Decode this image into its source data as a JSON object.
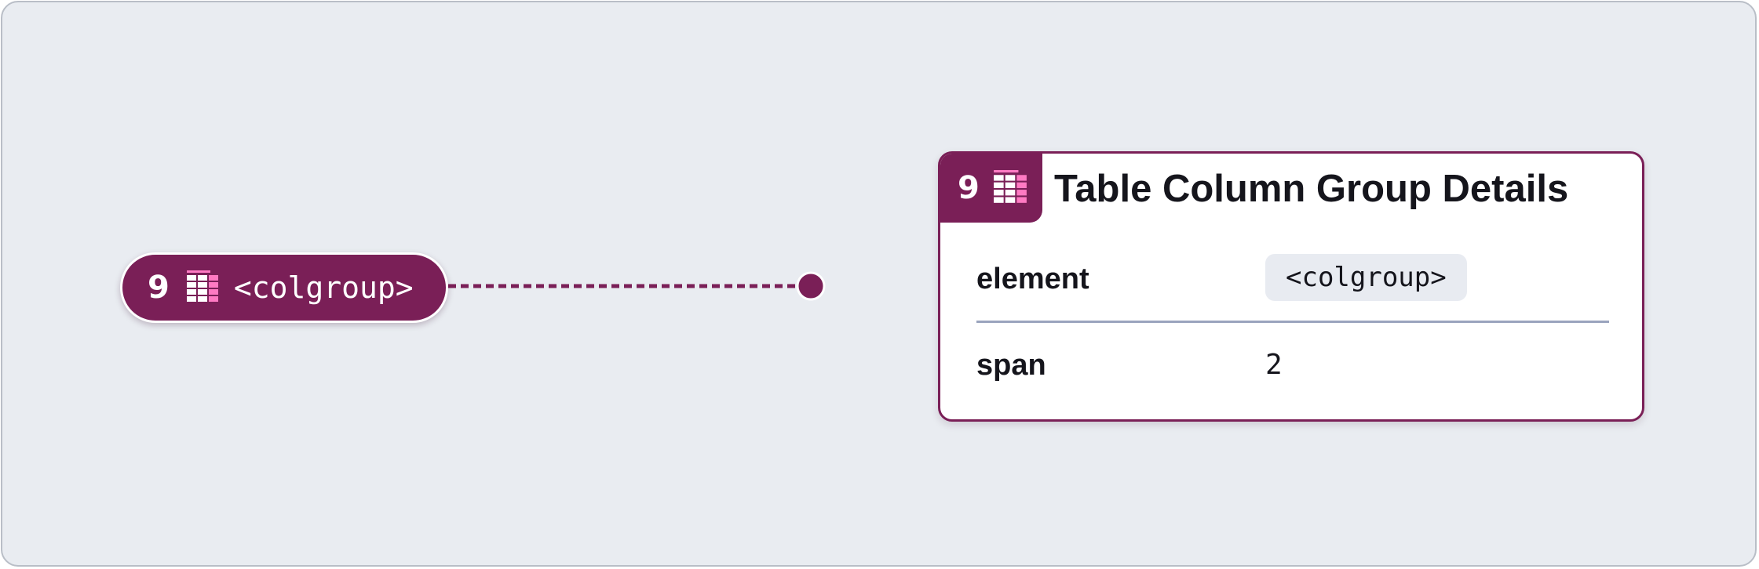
{
  "node": {
    "number": "9",
    "icon": "table-columns-icon",
    "label": "<colgroup>"
  },
  "card": {
    "number": "9",
    "icon": "table-columns-icon",
    "title": "Table Column Group Details",
    "rows": [
      {
        "key": "element",
        "value": "<colgroup>"
      },
      {
        "key": "span",
        "value": "2"
      }
    ]
  },
  "colors": {
    "accent": "#7a1f57",
    "icon_pink": "#ff7ac3",
    "background": "#e9ecf1",
    "divider": "#9aa4bd"
  }
}
